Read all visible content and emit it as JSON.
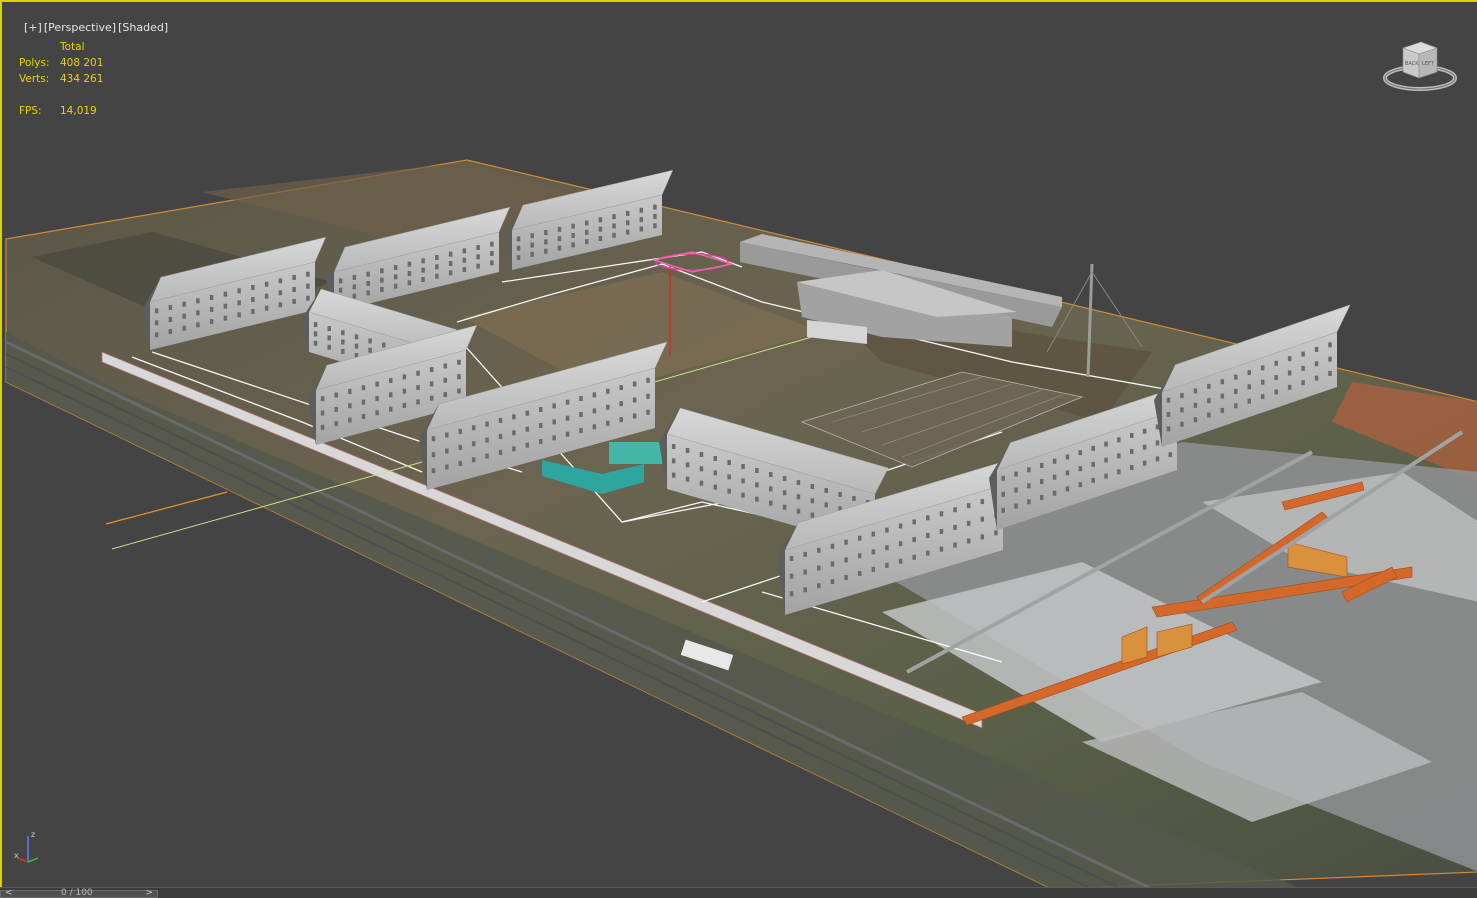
{
  "viewport": {
    "label_parts": [
      "[+]",
      "[Perspective]",
      "[Shaded]"
    ]
  },
  "stats": {
    "header": "Total",
    "polys_label": "Polys:",
    "polys_value": "408 201",
    "verts_label": "Verts:",
    "verts_value": "434 261",
    "fps_label": "FPS:",
    "fps_value": "14,019"
  },
  "viewcube": {
    "face_labels": [
      "BACK",
      "LEFT"
    ]
  },
  "axis": {
    "x": "x",
    "z": "z"
  },
  "timeline": {
    "prev": "<",
    "position": "0 / 100",
    "next": ">"
  },
  "colors": {
    "viewport_bg": "#444444",
    "active_border": "#d9d400",
    "stats_text": "#e8d300",
    "selection_orange": "#d4682a"
  }
}
